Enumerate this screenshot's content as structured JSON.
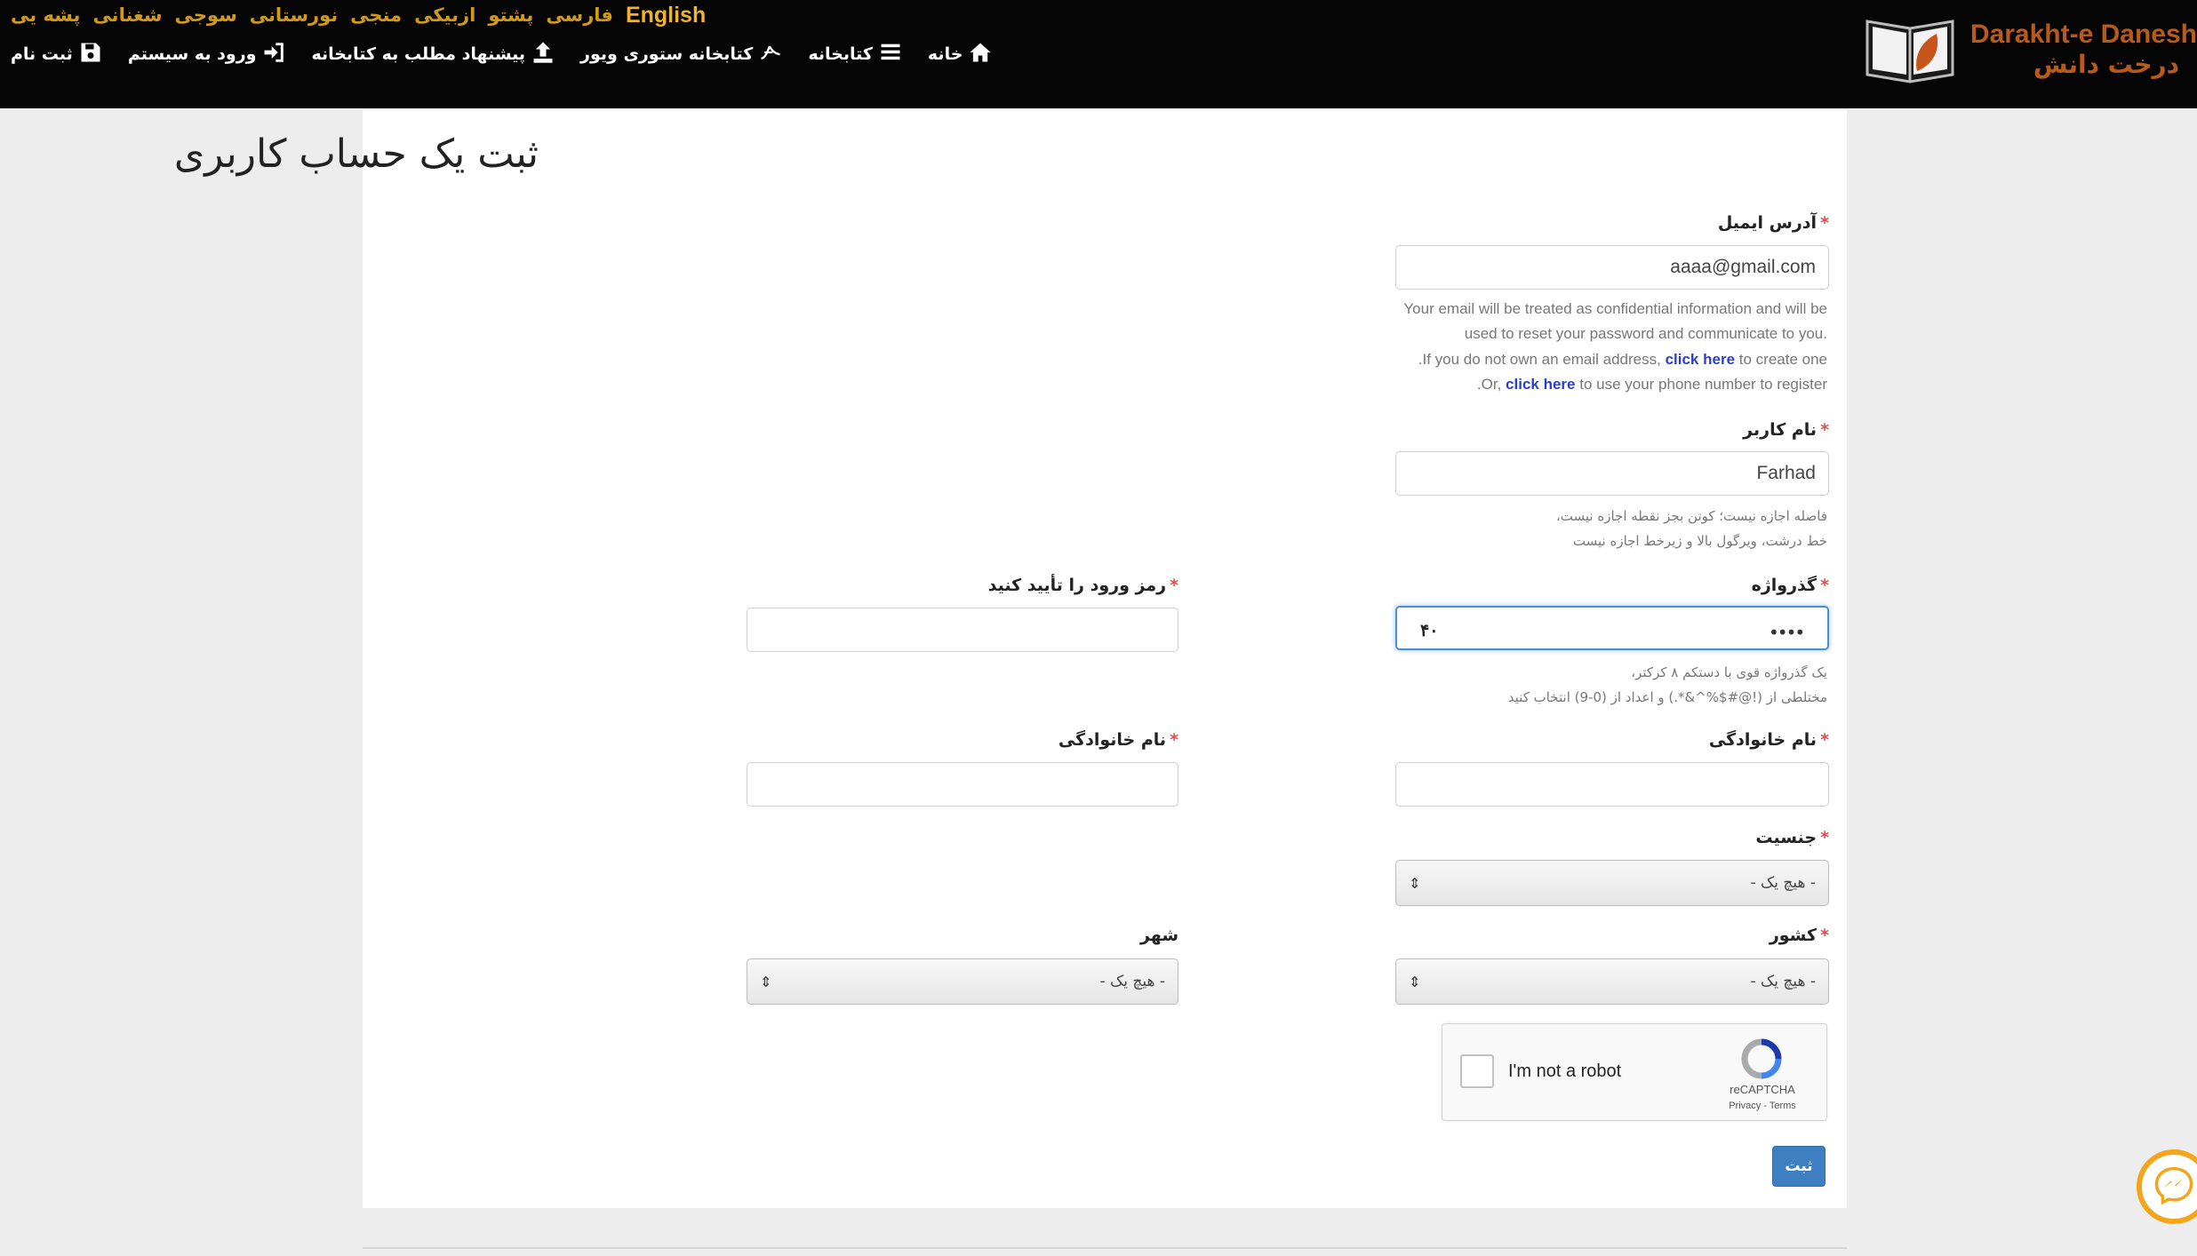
{
  "header": {
    "languages": [
      "English",
      "فارسی",
      "پشتو",
      "ازبیکی",
      "منجی",
      "نورستانی",
      "سوجی",
      "شغنانی",
      "پشه یی"
    ],
    "nav": [
      {
        "label": "خانه",
        "icon": "home-icon"
      },
      {
        "label": "کتابخانه",
        "icon": "list-icon"
      },
      {
        "label": "کتابخانه ستوری ویور",
        "icon": "storyweaver-icon"
      },
      {
        "label": "پیشنهاد مطلب به کتابخانه",
        "icon": "upload-icon"
      },
      {
        "label": "ورود به سیستم",
        "icon": "sign-in-icon"
      },
      {
        "label": "ثبت نام",
        "icon": "save-icon"
      }
    ],
    "brand_en": "Darakht-e Danesh",
    "brand_fa": "درخت دانش"
  },
  "form": {
    "title": "ثبت یک حساب کاربری",
    "required_mark": "*",
    "email": {
      "label": "آدرس ایمیل",
      "value": "aaaa@gmail.com",
      "help_line1": "Your email will be treated as confidential information and will be",
      "help_line2": ".used to reset your password and communicate to you",
      "help_line3_pre": ".If you do not own an email address, ",
      "help_line3_link": "click here",
      "help_line3_post": " to create one",
      "help_line4_pre": ".Or, ",
      "help_line4_link": "click here",
      "help_line4_post": " to use your phone number to register"
    },
    "username": {
      "label": "نام کاربر",
      "value": "Farhad",
      "help_line1": "فاصله اجازه نیست؛ کوتن بجز نقطه اجازه نیست،",
      "help_line2": "خط درشت، ویرگول بالا و زیرخط اجازه نیست"
    },
    "password": {
      "label": "گذرواژه",
      "value": "••••",
      "indicator": "۴۰",
      "help_line1": "یک گذرواژه قوی با دستکم ۸ کرکتر،",
      "help_line2": "مختلطی از (!@#$%^&*.) و اعداد از (0-9) انتخاب کنید"
    },
    "confirm_password": {
      "label": "رمز ورود را تأیید کنید",
      "value": ""
    },
    "last_name_right": {
      "label": "نام خانوادگی",
      "value": ""
    },
    "last_name_left": {
      "label": "نام خانوادگی",
      "value": ""
    },
    "gender": {
      "label": "جنسیت",
      "selected": "- هیچ یک -"
    },
    "country": {
      "label": "کشور",
      "selected": "- هیچ یک -"
    },
    "city": {
      "label": "شهر",
      "selected": "- هیچ یک -"
    },
    "captcha": {
      "text": "I'm not a robot",
      "brand": "reCAPTCHA",
      "links": "Privacy - Terms"
    },
    "submit_label": "ثبت"
  },
  "colors": {
    "brand": "#b75a1a",
    "lang": "#d19a1a",
    "submit": "#3e7fc1",
    "required": "#d9534f"
  }
}
